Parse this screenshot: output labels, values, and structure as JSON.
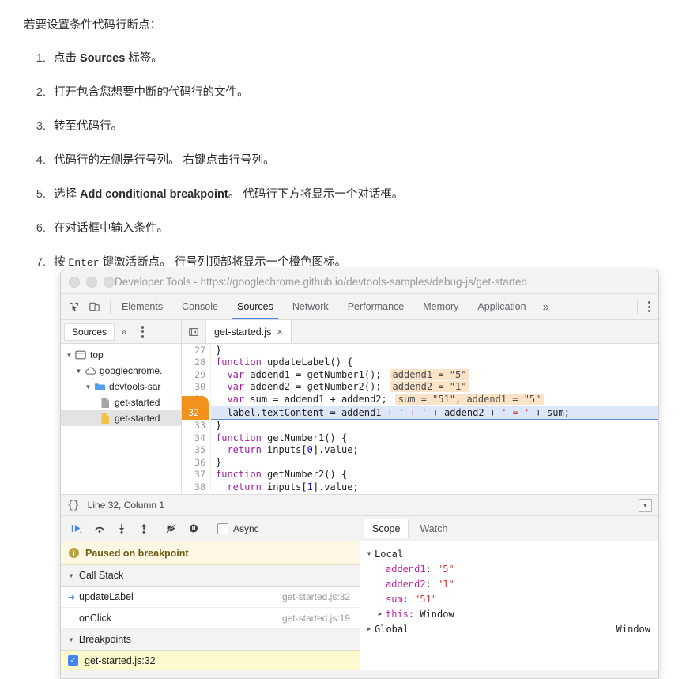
{
  "doc": {
    "intro": "若要设置条件代码行断点：",
    "steps": [
      {
        "pre": "点击 ",
        "bold": "Sources",
        "post": " 标签。"
      },
      {
        "pre": "打开包含您想要中断的代码行的文件。",
        "bold": "",
        "post": ""
      },
      {
        "pre": "转至代码行。",
        "bold": "",
        "post": ""
      },
      {
        "pre": "代码行的左侧是行号列。 右键点击行号列。",
        "bold": "",
        "post": ""
      },
      {
        "pre": "选择 ",
        "bold": "Add conditional breakpoint",
        "post": "。 代码行下方将显示一个对话框。"
      },
      {
        "pre": "在对话框中输入条件。",
        "bold": "",
        "post": ""
      },
      {
        "pre": "按 ",
        "kbd": "Enter",
        "post": " 键激活断点。 行号列顶部将显示一个橙色图标。"
      }
    ]
  },
  "window": {
    "title": "Developer Tools - https://googlechrome.github.io/devtools-samples/debug-js/get-started"
  },
  "devtools": {
    "tabs": [
      "Elements",
      "Console",
      "Sources",
      "Network",
      "Performance",
      "Memory",
      "Application"
    ],
    "active_tab": "Sources",
    "more_tabs_label": "»",
    "inspect_icon": "inspect-element-icon",
    "device_icon": "device-toolbar-icon"
  },
  "sources_pane": {
    "pane_tab": "Sources",
    "more_label": "»",
    "file_tab": "get-started.js",
    "file_tab_close": "×",
    "tree": [
      {
        "label": "top",
        "icon": "window-icon",
        "depth": 0,
        "expanded": true,
        "selected": false
      },
      {
        "label": "googlechrome.",
        "icon": "cloud-icon",
        "depth": 1,
        "expanded": true,
        "selected": false
      },
      {
        "label": "devtools-sar",
        "icon": "folder-icon",
        "depth": 2,
        "expanded": true,
        "selected": false
      },
      {
        "label": "get-started",
        "icon": "file-grey-icon",
        "depth": 3,
        "expanded": false,
        "selected": false
      },
      {
        "label": "get-started",
        "icon": "file-yellow-icon",
        "depth": 3,
        "expanded": false,
        "selected": true
      }
    ]
  },
  "editor": {
    "lines": [
      {
        "n": "27",
        "code": "}",
        "hint": "",
        "bp": false
      },
      {
        "n": "28",
        "code": "function updateLabel() {",
        "hint": "",
        "bp": false
      },
      {
        "n": "29",
        "code": "  var addend1 = getNumber1();",
        "hint": "addend1 = \"5\"",
        "bp": false
      },
      {
        "n": "30",
        "code": "  var addend2 = getNumber2();",
        "hint": "addend2 = \"1\"",
        "bp": false
      },
      {
        "n": "31",
        "code": "  var sum = addend1 + addend2;",
        "hint": "sum = \"51\", addend1 = \"5\"",
        "bp": false
      },
      {
        "n": "32",
        "code": "  label.textContent = addend1 + ' + ' + addend2 + ' = ' + sum;",
        "hint": "",
        "bp": true
      },
      {
        "n": "33",
        "code": "}",
        "hint": "",
        "bp": false
      },
      {
        "n": "34",
        "code": "function getNumber1() {",
        "hint": "",
        "bp": false
      },
      {
        "n": "35",
        "code": "  return inputs[0].value;",
        "hint": "",
        "bp": false
      },
      {
        "n": "36",
        "code": "}",
        "hint": "",
        "bp": false
      },
      {
        "n": "37",
        "code": "function getNumber2() {",
        "hint": "",
        "bp": false
      },
      {
        "n": "38",
        "code": "  return inputs[1].value;",
        "hint": "",
        "bp": false
      }
    ],
    "status": "Line 32, Column 1",
    "format_label": "{}"
  },
  "debugger": {
    "controls": [
      {
        "name": "resume-script-execution",
        "glyph": "▶"
      },
      {
        "name": "step-over-next-function-call",
        "glyph": "⤼"
      },
      {
        "name": "step-into-next-function-call",
        "glyph": "↓"
      },
      {
        "name": "step-out-of-current-function",
        "glyph": "↑"
      },
      {
        "name": "deactivate-breakpoints",
        "glyph": "⃠"
      },
      {
        "name": "pause-on-exceptions",
        "glyph": "⏸"
      }
    ],
    "async_label": "Async",
    "async_checked": false,
    "paused_message": "Paused on breakpoint",
    "call_stack_title": "Call Stack",
    "call_stack": [
      {
        "fn": "updateLabel",
        "loc": "get-started.js:32",
        "current": true
      },
      {
        "fn": "onClick",
        "loc": "get-started.js:19",
        "current": false
      }
    ],
    "breakpoints_title": "Breakpoints",
    "breakpoints": [
      {
        "label": "get-started.js:32",
        "checked": true
      }
    ]
  },
  "scope": {
    "tabs": [
      "Scope",
      "Watch"
    ],
    "active_tab": "Scope",
    "groups": [
      {
        "name": "Local",
        "expanded": true,
        "entries": [
          {
            "prop": "addend1",
            "value": "\"5\"",
            "expandable": false
          },
          {
            "prop": "addend2",
            "value": "\"1\"",
            "expandable": false
          },
          {
            "prop": "sum",
            "value": "\"51\"",
            "expandable": false
          },
          {
            "prop": "this",
            "value": "Window",
            "expandable": true
          }
        ]
      },
      {
        "name": "Global",
        "expanded": false,
        "entries": [],
        "right_value": "Window"
      }
    ]
  },
  "colors": {
    "accent": "#4285f4",
    "breakpoint": "#f2921d",
    "hint_bg": "#fbe3c8",
    "paused_bg": "#fdf8e3",
    "bp_row_bg": "#fdfacd"
  }
}
